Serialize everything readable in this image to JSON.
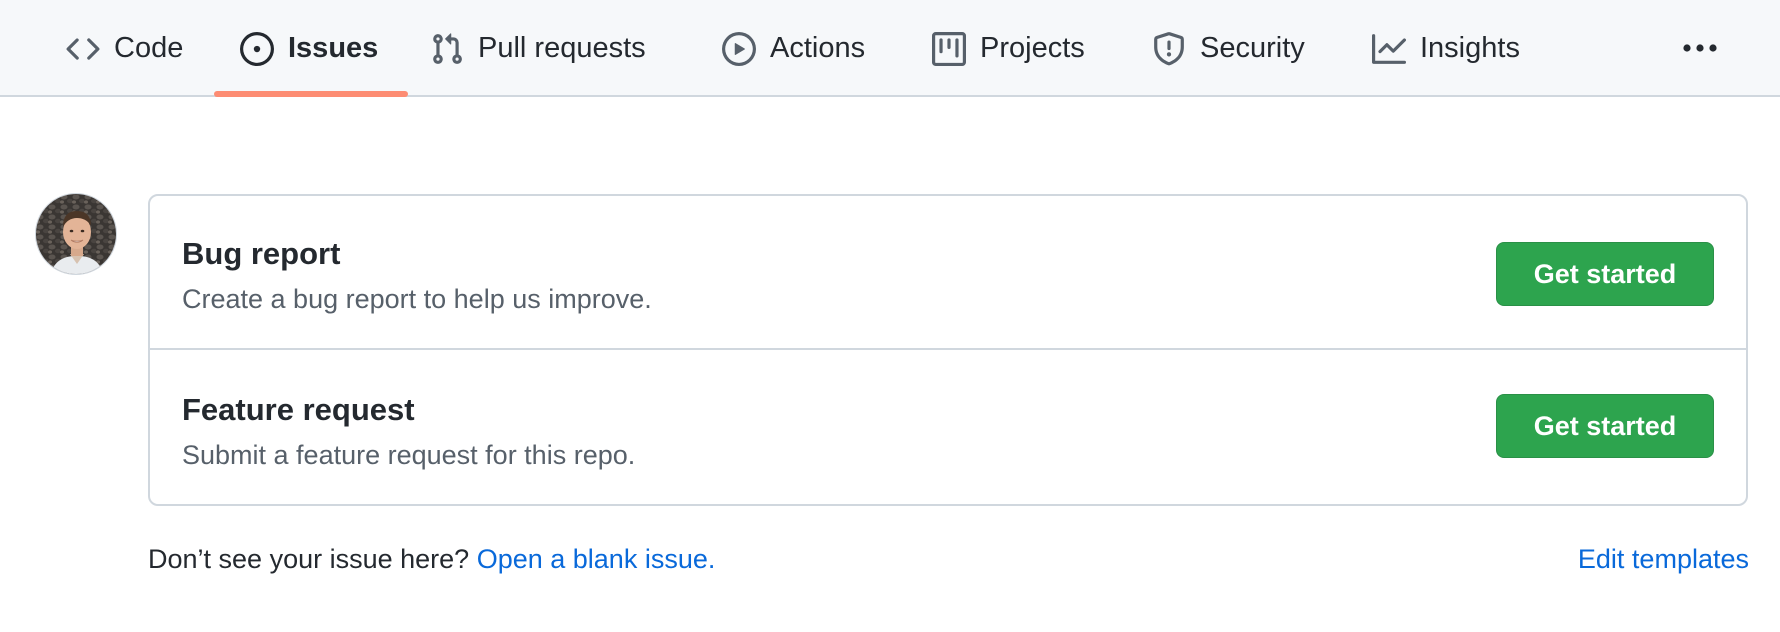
{
  "nav": {
    "tabs": [
      {
        "label": "Code",
        "icon": "code-icon",
        "selected": false
      },
      {
        "label": "Issues",
        "icon": "issue-opened-icon",
        "selected": true
      },
      {
        "label": "Pull requests",
        "icon": "git-pull-request-icon",
        "selected": false
      },
      {
        "label": "Actions",
        "icon": "play-icon",
        "selected": false
      },
      {
        "label": "Projects",
        "icon": "project-icon",
        "selected": false
      },
      {
        "label": "Security",
        "icon": "shield-icon",
        "selected": false
      },
      {
        "label": "Insights",
        "icon": "graph-icon",
        "selected": false
      }
    ],
    "more_icon": "kebab-horizontal-icon",
    "accent_color": "#fd8c73"
  },
  "templates": [
    {
      "title": "Bug report",
      "description": "Create a bug report to help us improve.",
      "button_label": "Get started"
    },
    {
      "title": "Feature request",
      "description": "Submit a feature request for this repo.",
      "button_label": "Get started"
    }
  ],
  "footer": {
    "prompt": "Don’t see your issue here?",
    "blank_issue_link": "Open a blank issue.",
    "edit_templates_link": "Edit templates"
  },
  "colors": {
    "primary_button": "#2da44e",
    "link": "#0969da"
  }
}
